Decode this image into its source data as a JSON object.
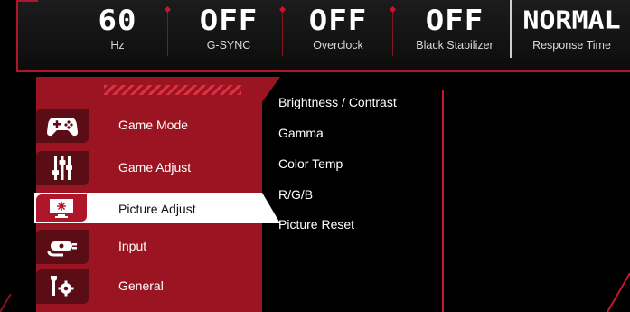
{
  "status_bar": {
    "items": [
      {
        "value": "60",
        "label": "Hz"
      },
      {
        "value": "OFF",
        "label": "G-SYNC"
      },
      {
        "value": "OFF",
        "label": "Overclock"
      },
      {
        "value": "OFF",
        "label": "Black Stabilizer"
      },
      {
        "value": "NORMAL",
        "label": "Response Time"
      }
    ]
  },
  "menu": {
    "items": [
      {
        "label": "Game Mode",
        "icon": "gamepad-icon",
        "active": false
      },
      {
        "label": "Game Adjust",
        "icon": "sliders-icon",
        "active": false
      },
      {
        "label": "Picture Adjust",
        "icon": "monitor-brightness-icon",
        "active": true
      },
      {
        "label": "Input",
        "icon": "cable-plug-icon",
        "active": false
      },
      {
        "label": "General",
        "icon": "wrench-gear-icon",
        "active": false
      }
    ]
  },
  "submenu": {
    "items": [
      {
        "label": "Brightness / Contrast"
      },
      {
        "label": "Gamma"
      },
      {
        "label": "Color Temp"
      },
      {
        "label": "R/G/B"
      },
      {
        "label": "Picture Reset"
      }
    ]
  },
  "colors": {
    "accent": "#c8162e",
    "menu_bg": "#9a1521",
    "active_bg": "#ffffff",
    "background": "#000000"
  }
}
